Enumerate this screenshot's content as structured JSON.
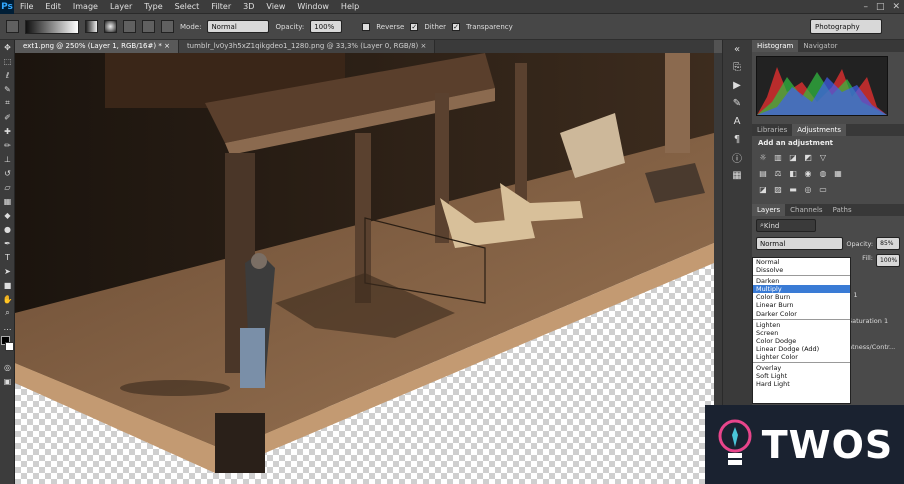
{
  "app": {
    "logo": "Ps"
  },
  "menu": [
    "File",
    "Edit",
    "Image",
    "Layer",
    "Type",
    "Select",
    "Filter",
    "3D",
    "View",
    "Window",
    "Help"
  ],
  "options": {
    "mode_label": "Mode:",
    "mode_value": "Normal",
    "opacity_label": "Opacity:",
    "opacity_value": "100%",
    "reverse": "Reverse",
    "dither": "Dither",
    "transparency": "Transparency",
    "workspace": "Photography"
  },
  "tabs": [
    {
      "label": "ext1.png @ 250% (Layer 1, RGB/16#) *"
    },
    {
      "label": "tumblr_lv0y3h5xZ1qikgdeo1_1280.png @ 33,3% (Layer 0, RGB/8)"
    }
  ],
  "panels": {
    "histogram_tab": "Histogram",
    "navigator_tab": "Navigator",
    "libraries_tab": "Libraries",
    "adjustments_tab": "Adjustments",
    "add_adjustment": "Add an adjustment",
    "layers_tab": "Layers",
    "channels_tab": "Channels",
    "paths_tab": "Paths",
    "kind": "Kind",
    "blend_value": "Normal",
    "opacity_label": "Opacity:",
    "opacity_value": "85%",
    "fill_label": "Fill:",
    "fill_value": "100%",
    "layer_1": "s 1",
    "layer_2": "Saturation 1",
    "layer_3": "htness/Contr..."
  },
  "blend_menu": {
    "groups": [
      [
        "Normal",
        "Dissolve"
      ],
      [
        "Darken",
        "Multiply",
        "Color Burn",
        "Linear Burn",
        "Darker Color"
      ],
      [
        "Lighten",
        "Screen",
        "Color Dodge",
        "Linear Dodge (Add)",
        "Lighter Color"
      ],
      [
        "Overlay",
        "Soft Light",
        "Hard Light"
      ]
    ],
    "selected": "Multiply"
  },
  "watermark": {
    "text": "TWOS"
  }
}
